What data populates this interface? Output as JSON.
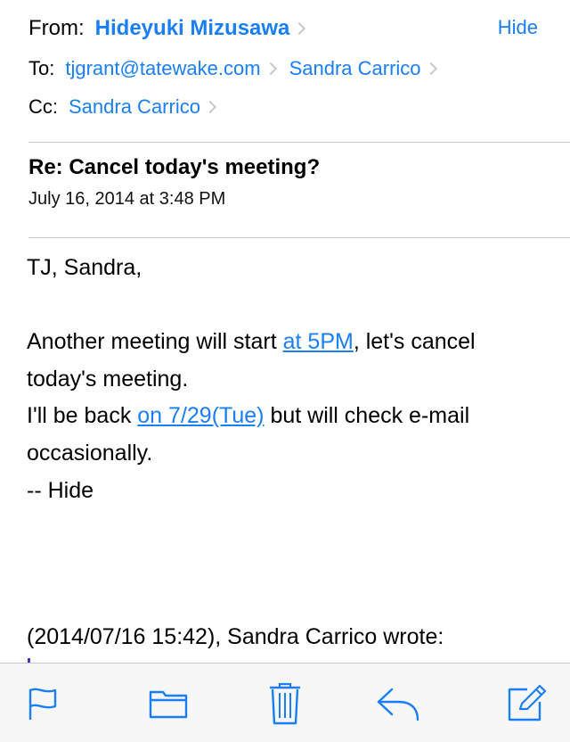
{
  "header": {
    "from_label": "From:",
    "from_name": "Hideyuki Mizusawa",
    "hide_label": "Hide",
    "to_label": "To:",
    "to_recipients": [
      "tjgrant@tatewake.com",
      "Sandra Carrico"
    ],
    "cc_label": "Cc:",
    "cc_recipients": [
      "Sandra Carrico"
    ]
  },
  "message": {
    "subject": "Re: Cancel today's meeting?",
    "date": "July 16, 2014 at 3:48 PM",
    "greeting": "TJ, Sandra,",
    "line1_pre": "Another meeting will start ",
    "line1_link": "at 5PM",
    "line1_post": ", let's cancel",
    "line2": "today's meeting.",
    "line3_pre": "I'll be back ",
    "line3_link": "on 7/29(Tue)",
    "line3_post": " but will check e-mail",
    "line4": "occasionally.",
    "signature": "-- Hide",
    "quote_header": "(2014/07/16 15:42), Sandra Carrico wrote:"
  },
  "toolbar": {
    "accent_color": "#1a7ef5",
    "icons": [
      "flag-icon",
      "folder-icon",
      "trash-icon",
      "reply-icon",
      "compose-icon"
    ]
  }
}
